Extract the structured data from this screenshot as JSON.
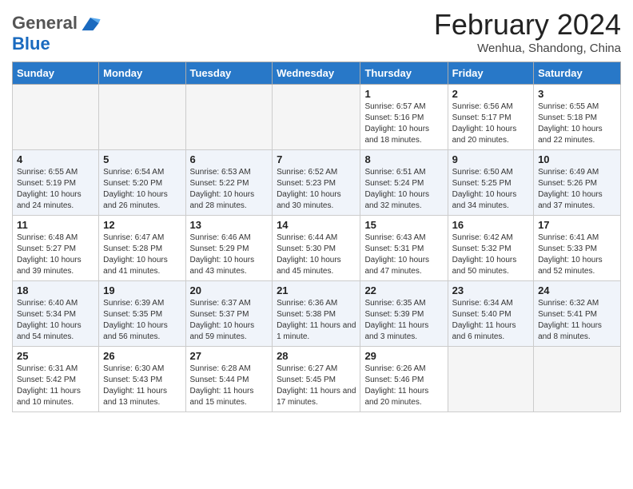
{
  "header": {
    "logo_general": "General",
    "logo_blue": "Blue",
    "month_title": "February 2024",
    "subtitle": "Wenhua, Shandong, China"
  },
  "days_of_week": [
    "Sunday",
    "Monday",
    "Tuesday",
    "Wednesday",
    "Thursday",
    "Friday",
    "Saturday"
  ],
  "weeks": [
    [
      {
        "day": "",
        "empty": true
      },
      {
        "day": "",
        "empty": true
      },
      {
        "day": "",
        "empty": true
      },
      {
        "day": "",
        "empty": true
      },
      {
        "day": "1",
        "sunrise": "6:57 AM",
        "sunset": "5:16 PM",
        "daylight": "10 hours and 18 minutes."
      },
      {
        "day": "2",
        "sunrise": "6:56 AM",
        "sunset": "5:17 PM",
        "daylight": "10 hours and 20 minutes."
      },
      {
        "day": "3",
        "sunrise": "6:55 AM",
        "sunset": "5:18 PM",
        "daylight": "10 hours and 22 minutes."
      }
    ],
    [
      {
        "day": "4",
        "sunrise": "6:55 AM",
        "sunset": "5:19 PM",
        "daylight": "10 hours and 24 minutes."
      },
      {
        "day": "5",
        "sunrise": "6:54 AM",
        "sunset": "5:20 PM",
        "daylight": "10 hours and 26 minutes."
      },
      {
        "day": "6",
        "sunrise": "6:53 AM",
        "sunset": "5:22 PM",
        "daylight": "10 hours and 28 minutes."
      },
      {
        "day": "7",
        "sunrise": "6:52 AM",
        "sunset": "5:23 PM",
        "daylight": "10 hours and 30 minutes."
      },
      {
        "day": "8",
        "sunrise": "6:51 AM",
        "sunset": "5:24 PM",
        "daylight": "10 hours and 32 minutes."
      },
      {
        "day": "9",
        "sunrise": "6:50 AM",
        "sunset": "5:25 PM",
        "daylight": "10 hours and 34 minutes."
      },
      {
        "day": "10",
        "sunrise": "6:49 AM",
        "sunset": "5:26 PM",
        "daylight": "10 hours and 37 minutes."
      }
    ],
    [
      {
        "day": "11",
        "sunrise": "6:48 AM",
        "sunset": "5:27 PM",
        "daylight": "10 hours and 39 minutes."
      },
      {
        "day": "12",
        "sunrise": "6:47 AM",
        "sunset": "5:28 PM",
        "daylight": "10 hours and 41 minutes."
      },
      {
        "day": "13",
        "sunrise": "6:46 AM",
        "sunset": "5:29 PM",
        "daylight": "10 hours and 43 minutes."
      },
      {
        "day": "14",
        "sunrise": "6:44 AM",
        "sunset": "5:30 PM",
        "daylight": "10 hours and 45 minutes."
      },
      {
        "day": "15",
        "sunrise": "6:43 AM",
        "sunset": "5:31 PM",
        "daylight": "10 hours and 47 minutes."
      },
      {
        "day": "16",
        "sunrise": "6:42 AM",
        "sunset": "5:32 PM",
        "daylight": "10 hours and 50 minutes."
      },
      {
        "day": "17",
        "sunrise": "6:41 AM",
        "sunset": "5:33 PM",
        "daylight": "10 hours and 52 minutes."
      }
    ],
    [
      {
        "day": "18",
        "sunrise": "6:40 AM",
        "sunset": "5:34 PM",
        "daylight": "10 hours and 54 minutes."
      },
      {
        "day": "19",
        "sunrise": "6:39 AM",
        "sunset": "5:35 PM",
        "daylight": "10 hours and 56 minutes."
      },
      {
        "day": "20",
        "sunrise": "6:37 AM",
        "sunset": "5:37 PM",
        "daylight": "10 hours and 59 minutes."
      },
      {
        "day": "21",
        "sunrise": "6:36 AM",
        "sunset": "5:38 PM",
        "daylight": "11 hours and 1 minute."
      },
      {
        "day": "22",
        "sunrise": "6:35 AM",
        "sunset": "5:39 PM",
        "daylight": "11 hours and 3 minutes."
      },
      {
        "day": "23",
        "sunrise": "6:34 AM",
        "sunset": "5:40 PM",
        "daylight": "11 hours and 6 minutes."
      },
      {
        "day": "24",
        "sunrise": "6:32 AM",
        "sunset": "5:41 PM",
        "daylight": "11 hours and 8 minutes."
      }
    ],
    [
      {
        "day": "25",
        "sunrise": "6:31 AM",
        "sunset": "5:42 PM",
        "daylight": "11 hours and 10 minutes."
      },
      {
        "day": "26",
        "sunrise": "6:30 AM",
        "sunset": "5:43 PM",
        "daylight": "11 hours and 13 minutes."
      },
      {
        "day": "27",
        "sunrise": "6:28 AM",
        "sunset": "5:44 PM",
        "daylight": "11 hours and 15 minutes."
      },
      {
        "day": "28",
        "sunrise": "6:27 AM",
        "sunset": "5:45 PM",
        "daylight": "11 hours and 17 minutes."
      },
      {
        "day": "29",
        "sunrise": "6:26 AM",
        "sunset": "5:46 PM",
        "daylight": "11 hours and 20 minutes."
      },
      {
        "day": "",
        "empty": true
      },
      {
        "day": "",
        "empty": true
      }
    ]
  ]
}
